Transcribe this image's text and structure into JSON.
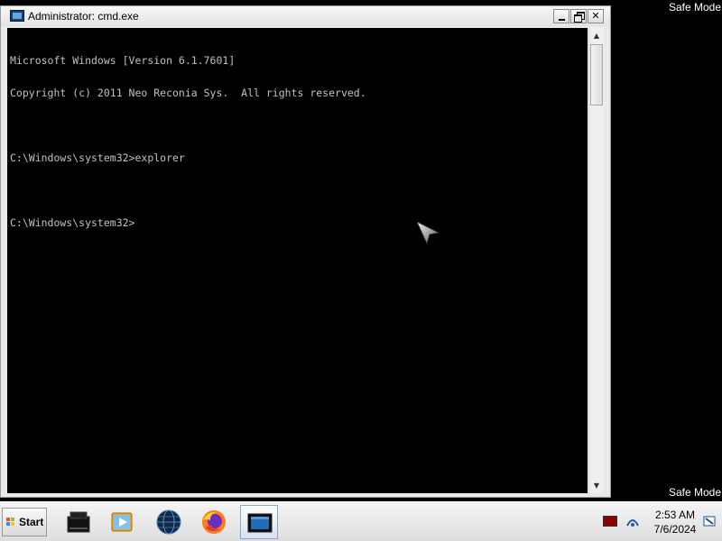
{
  "desktop": {
    "safe_mode_top": "Safe Mode",
    "safe_mode_bottom": "Safe Mode"
  },
  "window": {
    "title": "Administrator: cmd.exe",
    "icon": "cmd-window-icon",
    "controls": {
      "minimize": "minimize-icon",
      "maximize": "restore-icon",
      "close": "close-icon"
    }
  },
  "console": {
    "lines": [
      "Microsoft Windows [Version 6.1.7601]",
      "Copyright (c) 2011 Neo Reconia Sys.  All rights reserved.",
      "",
      "C:\\Windows\\system32>explorer",
      "",
      "C:\\Windows\\system32>"
    ]
  },
  "taskbar": {
    "start_label": "Start",
    "apps": [
      {
        "name": "tray-app-icon",
        "active": false
      },
      {
        "name": "media-player-icon",
        "active": false
      },
      {
        "name": "globe-browser-icon",
        "active": false
      },
      {
        "name": "firefox-icon",
        "active": false
      },
      {
        "name": "cmd-window-icon",
        "active": true
      }
    ],
    "clock": {
      "time": "2:53 AM",
      "date": "7/6/2024"
    }
  },
  "colors": {
    "console_bg": "#000000",
    "console_fg": "#c0c0c0",
    "taskbar_bg": "#e4e4e4",
    "title_bg": "#ededed"
  }
}
